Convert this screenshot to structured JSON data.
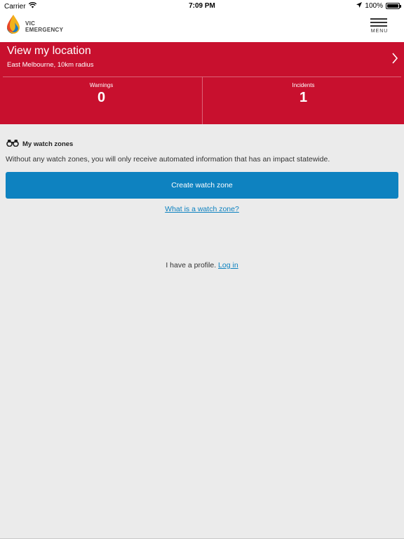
{
  "status_bar": {
    "carrier": "Carrier",
    "time": "7:09 PM",
    "battery": "100%"
  },
  "header": {
    "logo_line1": "VIC",
    "logo_line2": "EMERGENCY",
    "menu_label": "MENU"
  },
  "location": {
    "title": "View my location",
    "subtitle": "East Melbourne, 10km radius",
    "warnings_label": "Warnings",
    "warnings_count": "0",
    "incidents_label": "Incidents",
    "incidents_count": "1",
    "background_color": "#c8102e"
  },
  "watch_zones": {
    "title": "My watch zones",
    "description": "Without any watch zones, you will only receive automated information that has an impact statewide.",
    "create_button": "Create watch zone",
    "what_link": "What is a watch zone?",
    "button_color": "#0e82c0"
  },
  "profile": {
    "text": "I have a profile.",
    "login_link": "Log in"
  }
}
